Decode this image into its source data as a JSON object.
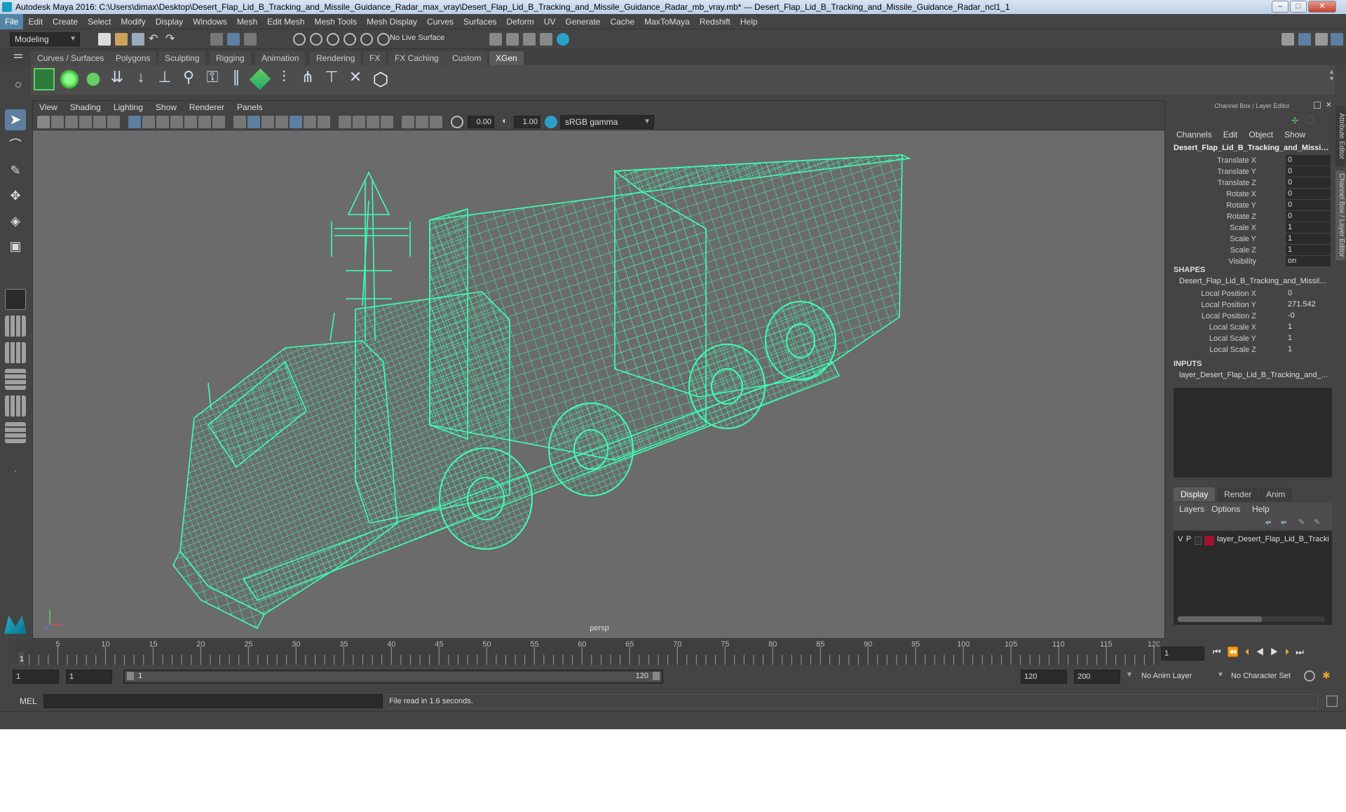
{
  "window": {
    "title": "Autodesk Maya 2016: C:\\Users\\dimax\\Desktop\\Desert_Flap_Lid_B_Tracking_and_Missile_Guidance_Radar_max_vray\\Desert_Flap_Lid_B_Tracking_and_Missile_Guidance_Radar_mb_vray.mb*   ---   Desert_Flap_Lid_B_Tracking_and_Missile_Guidance_Radar_ncl1_1",
    "min": "–",
    "max": "□",
    "close": "✕"
  },
  "menu": [
    "File",
    "Edit",
    "Create",
    "Select",
    "Modify",
    "Display",
    "Windows",
    "Mesh",
    "Edit Mesh",
    "Mesh Tools",
    "Mesh Display",
    "Curves",
    "Surfaces",
    "Deform",
    "UV",
    "Generate",
    "Cache",
    "MaxToMaya",
    "Redshift",
    "Help"
  ],
  "status": {
    "mode": "Modeling",
    "live_surface": "No Live Surface"
  },
  "shelf_tabs": [
    "Curves / Surfaces",
    "Polygons",
    "Sculpting",
    "Rigging",
    "Animation",
    "Rendering",
    "FX",
    "FX Caching",
    "Custom",
    "XGen"
  ],
  "active_shelf_tab": "XGen",
  "viewport": {
    "menu": [
      "View",
      "Shading",
      "Lighting",
      "Show",
      "Renderer",
      "Panels"
    ],
    "exposure": "0.00",
    "gamma": "1.00",
    "colorspace": "sRGB gamma",
    "camera": "persp",
    "wire_color": "#3dffb4"
  },
  "channel_box": {
    "title": "Channel Box / Layer Editor",
    "menu": [
      "Channels",
      "Edit",
      "Object",
      "Show"
    ],
    "node": "Desert_Flap_Lid_B_Tracking_and_Missile...",
    "attrs": [
      {
        "label": "Translate X",
        "value": "0"
      },
      {
        "label": "Translate Y",
        "value": "0"
      },
      {
        "label": "Translate Z",
        "value": "0"
      },
      {
        "label": "Rotate X",
        "value": "0"
      },
      {
        "label": "Rotate Y",
        "value": "0"
      },
      {
        "label": "Rotate Z",
        "value": "0"
      },
      {
        "label": "Scale X",
        "value": "1"
      },
      {
        "label": "Scale Y",
        "value": "1"
      },
      {
        "label": "Scale Z",
        "value": "1"
      },
      {
        "label": "Visibility",
        "value": "on"
      }
    ],
    "shapes_header": "SHAPES",
    "shape_node": "Desert_Flap_Lid_B_Tracking_and_Missil...",
    "shape_attrs": [
      {
        "label": "Local Position X",
        "value": "0"
      },
      {
        "label": "Local Position Y",
        "value": "271.542"
      },
      {
        "label": "Local Position Z",
        "value": "-0"
      },
      {
        "label": "Local Scale X",
        "value": "1"
      },
      {
        "label": "Local Scale Y",
        "value": "1"
      },
      {
        "label": "Local Scale Z",
        "value": "1"
      }
    ],
    "inputs_header": "INPUTS",
    "input_node": "layer_Desert_Flap_Lid_B_Tracking_and_..."
  },
  "layer_editor": {
    "tabs": [
      "Display",
      "Render",
      "Anim"
    ],
    "active": "Display",
    "menu": [
      "Layers",
      "Options",
      "Help"
    ],
    "layer": {
      "v": "V",
      "p": "P",
      "name": "layer_Desert_Flap_Lid_B_Trackir",
      "color": "#a0122b"
    }
  },
  "side_tabs": [
    "Attribute Editor",
    "Channel Box / Layer Editor"
  ],
  "timeline": {
    "ticks": [
      "5",
      "10",
      "15",
      "20",
      "25",
      "30",
      "35",
      "40",
      "45",
      "50",
      "55",
      "60",
      "65",
      "70",
      "75",
      "80",
      "85",
      "90",
      "95",
      "100",
      "105",
      "110",
      "115",
      "120"
    ],
    "current": "1",
    "current_field": "1"
  },
  "range": {
    "start": "1",
    "start2": "1",
    "slider_start": "1",
    "slider_end": "120",
    "end": "120",
    "end2": "200",
    "anim_layer": "No Anim Layer",
    "char_set": "No Character Set"
  },
  "command": {
    "lang": "MEL",
    "feedback": "File read in  1.6 seconds."
  }
}
